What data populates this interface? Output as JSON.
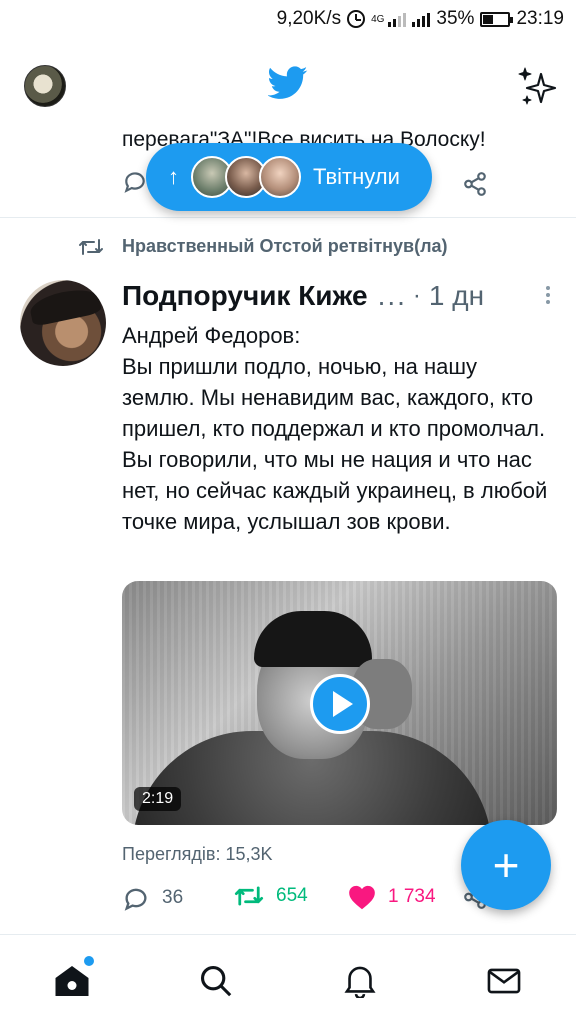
{
  "status_bar": {
    "speed": "9,20K/s",
    "network": "4G",
    "battery": "35%",
    "time": "23:19"
  },
  "header": {
    "logo": "twitter-bird-icon",
    "sparkle": "sparkle-icon"
  },
  "prev_tweet": {
    "text_fragment": "перевага\"ЗА\"!Все висить на Волоску!"
  },
  "new_tweets_pill": {
    "arrow": "↑",
    "label": "Твітнули"
  },
  "tweet": {
    "retweeted_by": "Нравственный Отстой ретвітнув(ла)",
    "author_name": "Подпоручик Киже",
    "ellipsis": "...",
    "separator": "·",
    "time": "1 дн",
    "text_lines": [
      "Андрей Федоров:",
      "Вы пришли подло, ночью, на нашу землю. Мы ненавидим вас, каждого, кто пришел, кто поддержал и кто промолчал. Вы говорили, что мы не нация и что нас нет, но сейчас каждый украинец, в любой точке мира, услышал зов крови."
    ],
    "video_duration": "2:19",
    "views": "Переглядів: 15,3K",
    "replies": "36",
    "retweets": "654",
    "likes": "1 734"
  },
  "fab": {
    "label": "+"
  },
  "colors": {
    "accent": "#1d9bf0",
    "retweet": "#00ba7c",
    "like": "#f91880",
    "muted": "#536471"
  }
}
